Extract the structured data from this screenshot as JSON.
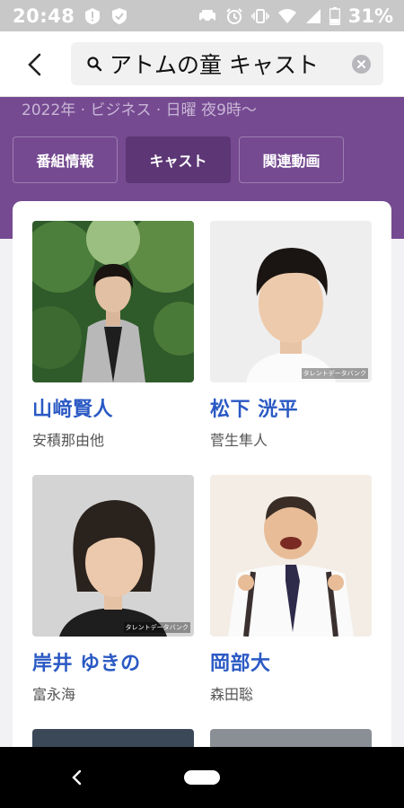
{
  "status_bar": {
    "time": "20:48",
    "battery": "31%"
  },
  "search": {
    "query": "アトムの童 キャスト"
  },
  "program": {
    "meta": "2022年 · ビジネス · 日曜 夜9時〜"
  },
  "tabs": [
    {
      "label": "番組情報",
      "active": false
    },
    {
      "label": "キャスト",
      "active": true
    },
    {
      "label": "関連動画",
      "active": false
    }
  ],
  "cast": [
    {
      "name": "山﨑賢人",
      "role": "安積那由他",
      "credit": ""
    },
    {
      "name": "松下 洸平",
      "role": "菅生隼人",
      "credit": "タレントデータバンク"
    },
    {
      "name": "岸井 ゆきの",
      "role": "富永海",
      "credit": "タレントデータバンク"
    },
    {
      "name": "岡部大",
      "role": "森田聡",
      "credit": ""
    }
  ],
  "colors": {
    "brand_purple": "#754a91",
    "active_tab": "#5d3675",
    "cast_name": "#2a59c4"
  },
  "icons": {
    "status_left": [
      "alert-icon",
      "shield-check-icon"
    ],
    "status_right": [
      "car-icon",
      "alarm-icon",
      "vibrate-icon",
      "wifi-icon",
      "signal-icon",
      "battery-icon"
    ],
    "header": [
      "back-arrow-icon",
      "search-icon",
      "clear-icon"
    ],
    "nav": [
      "nav-back-icon",
      "nav-home-pill"
    ]
  }
}
